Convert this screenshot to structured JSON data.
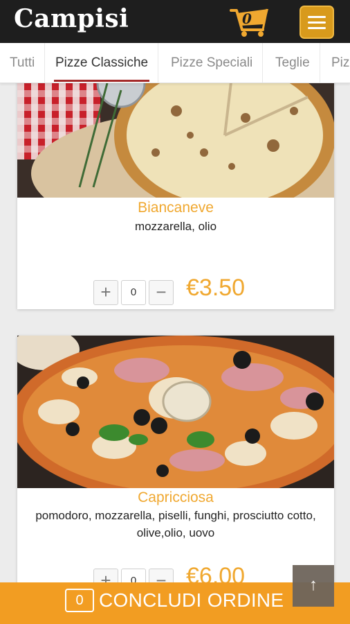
{
  "app": {
    "brand": "Campisi",
    "cart_count": "0",
    "menu_icon": "hamburger-menu-icon",
    "accent_color": "#f0a830",
    "header_color": "#1e1e1e"
  },
  "tabs": [
    {
      "label": "Tutti",
      "active": false
    },
    {
      "label": "Pizze Classiche",
      "active": true
    },
    {
      "label": "Pizze Speciali",
      "active": false
    },
    {
      "label": "Teglie",
      "active": false
    },
    {
      "label": "Piz",
      "active": false
    }
  ],
  "products": [
    {
      "name": "Biancaneve",
      "description": "mozzarella, olio",
      "quantity": "0",
      "plus": "+",
      "minus": "−",
      "price": "€3.50"
    },
    {
      "name": "Capricciosa",
      "description": "pomodoro, mozzarella, piselli, funghi, prosciutto cotto, olive,olio, uovo",
      "quantity": "0",
      "plus": "+",
      "minus": "−",
      "price": "€6.00"
    }
  ],
  "footer": {
    "order_count": "0",
    "order_label": "CONCLUDI ORDINE",
    "to_top": "↑"
  }
}
